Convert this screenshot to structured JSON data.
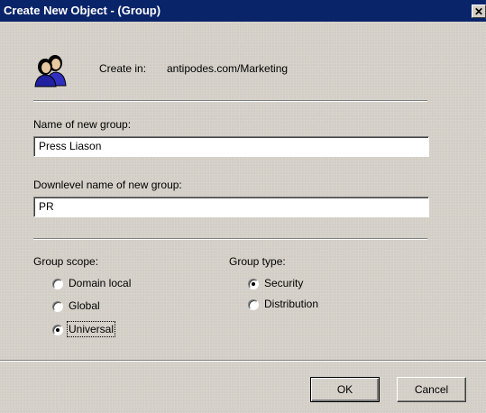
{
  "window": {
    "title": "Create New Object - (Group)",
    "close_glyph": "✕"
  },
  "header": {
    "icon": "group-people-icon",
    "create_in_label": "Create in:",
    "create_in_path": "antipodes.com/Marketing"
  },
  "name_field": {
    "label": "Name of new group:",
    "value": "Press Liason"
  },
  "downlevel_field": {
    "label": "Downlevel name of new group:",
    "value": "PR"
  },
  "group_scope": {
    "label": "Group scope:",
    "options": [
      {
        "label": "Domain local",
        "selected": false
      },
      {
        "label": "Global",
        "selected": false
      },
      {
        "label": "Universal",
        "selected": true
      }
    ]
  },
  "group_type": {
    "label": "Group type:",
    "options": [
      {
        "label": "Security",
        "selected": true
      },
      {
        "label": "Distribution",
        "selected": false
      }
    ]
  },
  "buttons": {
    "ok": "OK",
    "cancel": "Cancel"
  },
  "colors": {
    "titlebar": "#0a246a",
    "dialog_bg": "#d4d0c8"
  }
}
